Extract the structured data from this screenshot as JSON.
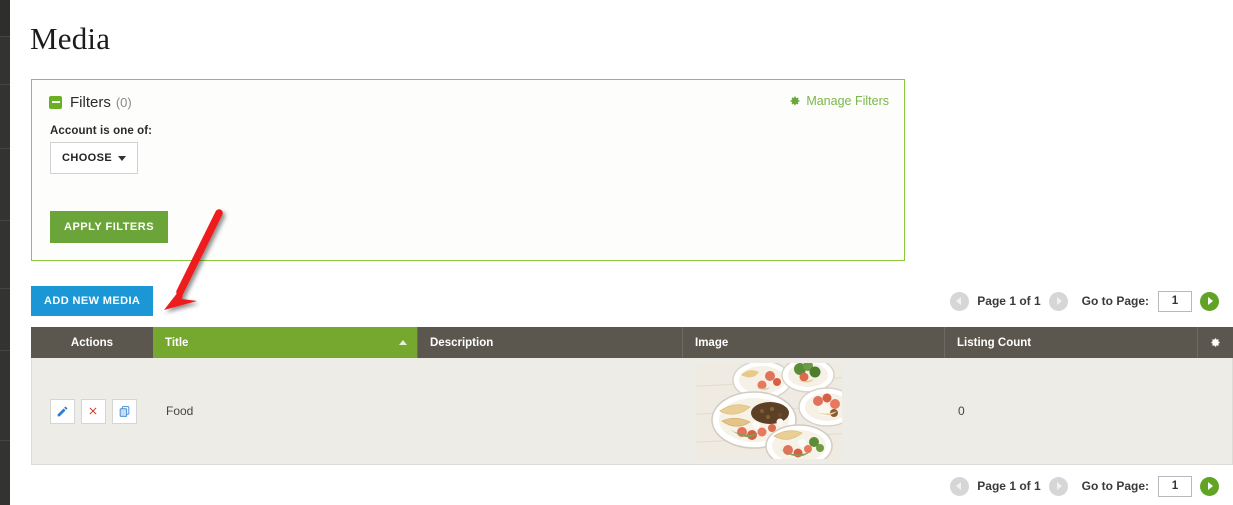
{
  "page": {
    "title": "Media"
  },
  "filters": {
    "label": "Filters",
    "count": "(0)",
    "collapse_icon": "minus-square-icon",
    "manage_link": "Manage Filters",
    "manage_icon": "gear-icon",
    "account_label": "Account is one of:",
    "choose_button": "CHOOSE",
    "choose_caret_icon": "caret-down-icon",
    "apply_button": "APPLY FILTERS",
    "border_color": "#8cc63e",
    "apply_color": "#6ba539"
  },
  "toolbar": {
    "add_new_media": "ADD NEW MEDIA",
    "add_new_media_color": "#1b97d5"
  },
  "pagination": {
    "prev_icon": "chevron-left-circle-icon",
    "next_icon": "chevron-right-circle-icon",
    "page_status": "Page 1 of 1",
    "goto_label": "Go to Page:",
    "goto_value": "1",
    "goto_placeholder": "1",
    "go_icon": "chevron-right-circle-green-icon",
    "go_color": "#61a425"
  },
  "table": {
    "header_color": "#5b574e",
    "sorted_column_color": "#76a72f",
    "sort_direction": "ascending",
    "settings_icon": "gear-icon",
    "columns": [
      {
        "key": "actions",
        "label": "Actions"
      },
      {
        "key": "title",
        "label": "Title"
      },
      {
        "key": "description",
        "label": "Description"
      },
      {
        "key": "image",
        "label": "Image"
      },
      {
        "key": "listing_count",
        "label": "Listing Count"
      }
    ],
    "rows": [
      {
        "actions": [
          {
            "name": "edit-button",
            "icon": "pencil-icon",
            "color": "#2f7fd0"
          },
          {
            "name": "delete-button",
            "icon": "times-icon",
            "color": "#d9362b"
          },
          {
            "name": "copy-button",
            "icon": "copy-icon",
            "color": "#4a8fd4"
          }
        ],
        "title": "Food",
        "description": "",
        "image_alt": "food-bowls-thumbnail",
        "listing_count": "0"
      }
    ]
  },
  "annotation": {
    "arrow_color": "#ee1c1c",
    "arrow_name": "red-annotation-arrow"
  }
}
